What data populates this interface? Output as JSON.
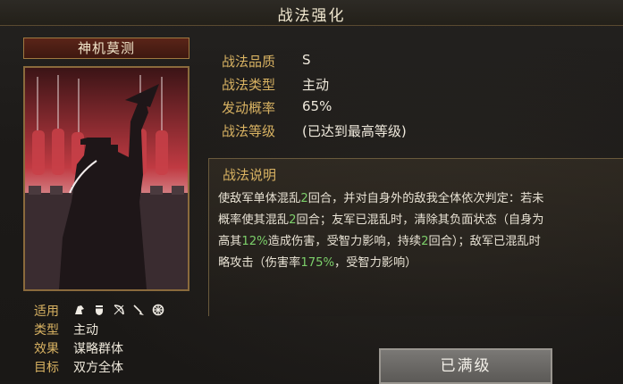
{
  "header": {
    "title": "战法强化"
  },
  "card": {
    "name": "神机莫测",
    "applies_label": "适用",
    "applies_icons": [
      "cavalry-icon",
      "shield-icon",
      "bow-icon",
      "spear-icon",
      "wheel-icon"
    ],
    "type_label": "类型",
    "type_value": "主动",
    "effect_label": "效果",
    "effect_value": "谋略群体",
    "target_label": "目标",
    "target_value": "双方全体"
  },
  "info": {
    "quality_label": "战法品质",
    "quality_value": "S",
    "kind_label": "战法类型",
    "kind_value": "主动",
    "rate_label": "发动概率",
    "rate_value": "65%",
    "level_label": "战法等级",
    "level_value": "(已达到最高等级)"
  },
  "description": {
    "title": "战法说明",
    "line1": {
      "a": "使敌军单体混乱",
      "b": "2",
      "c": "回合，并对自身外的敌我全体依次判定：若未"
    },
    "line2": {
      "a": "概率使其混乱",
      "b": "2",
      "c": "回合；友军已混乱时，清除其负面状态（自身为"
    },
    "line3": {
      "a": "高其",
      "b": "12%",
      "c": "造成伤害，受智力影响，持续",
      "d": "2",
      "e": "回合）；敌军已混乱时"
    },
    "line4": {
      "a": "略攻击（伤害率",
      "b": "175%",
      "c": "，受智力影响）"
    }
  },
  "button": {
    "label": "已满级"
  },
  "colors": {
    "accent_gold": "#d8b262",
    "highlight_green": "#7ccf6a",
    "card_red": "#b8343a"
  }
}
